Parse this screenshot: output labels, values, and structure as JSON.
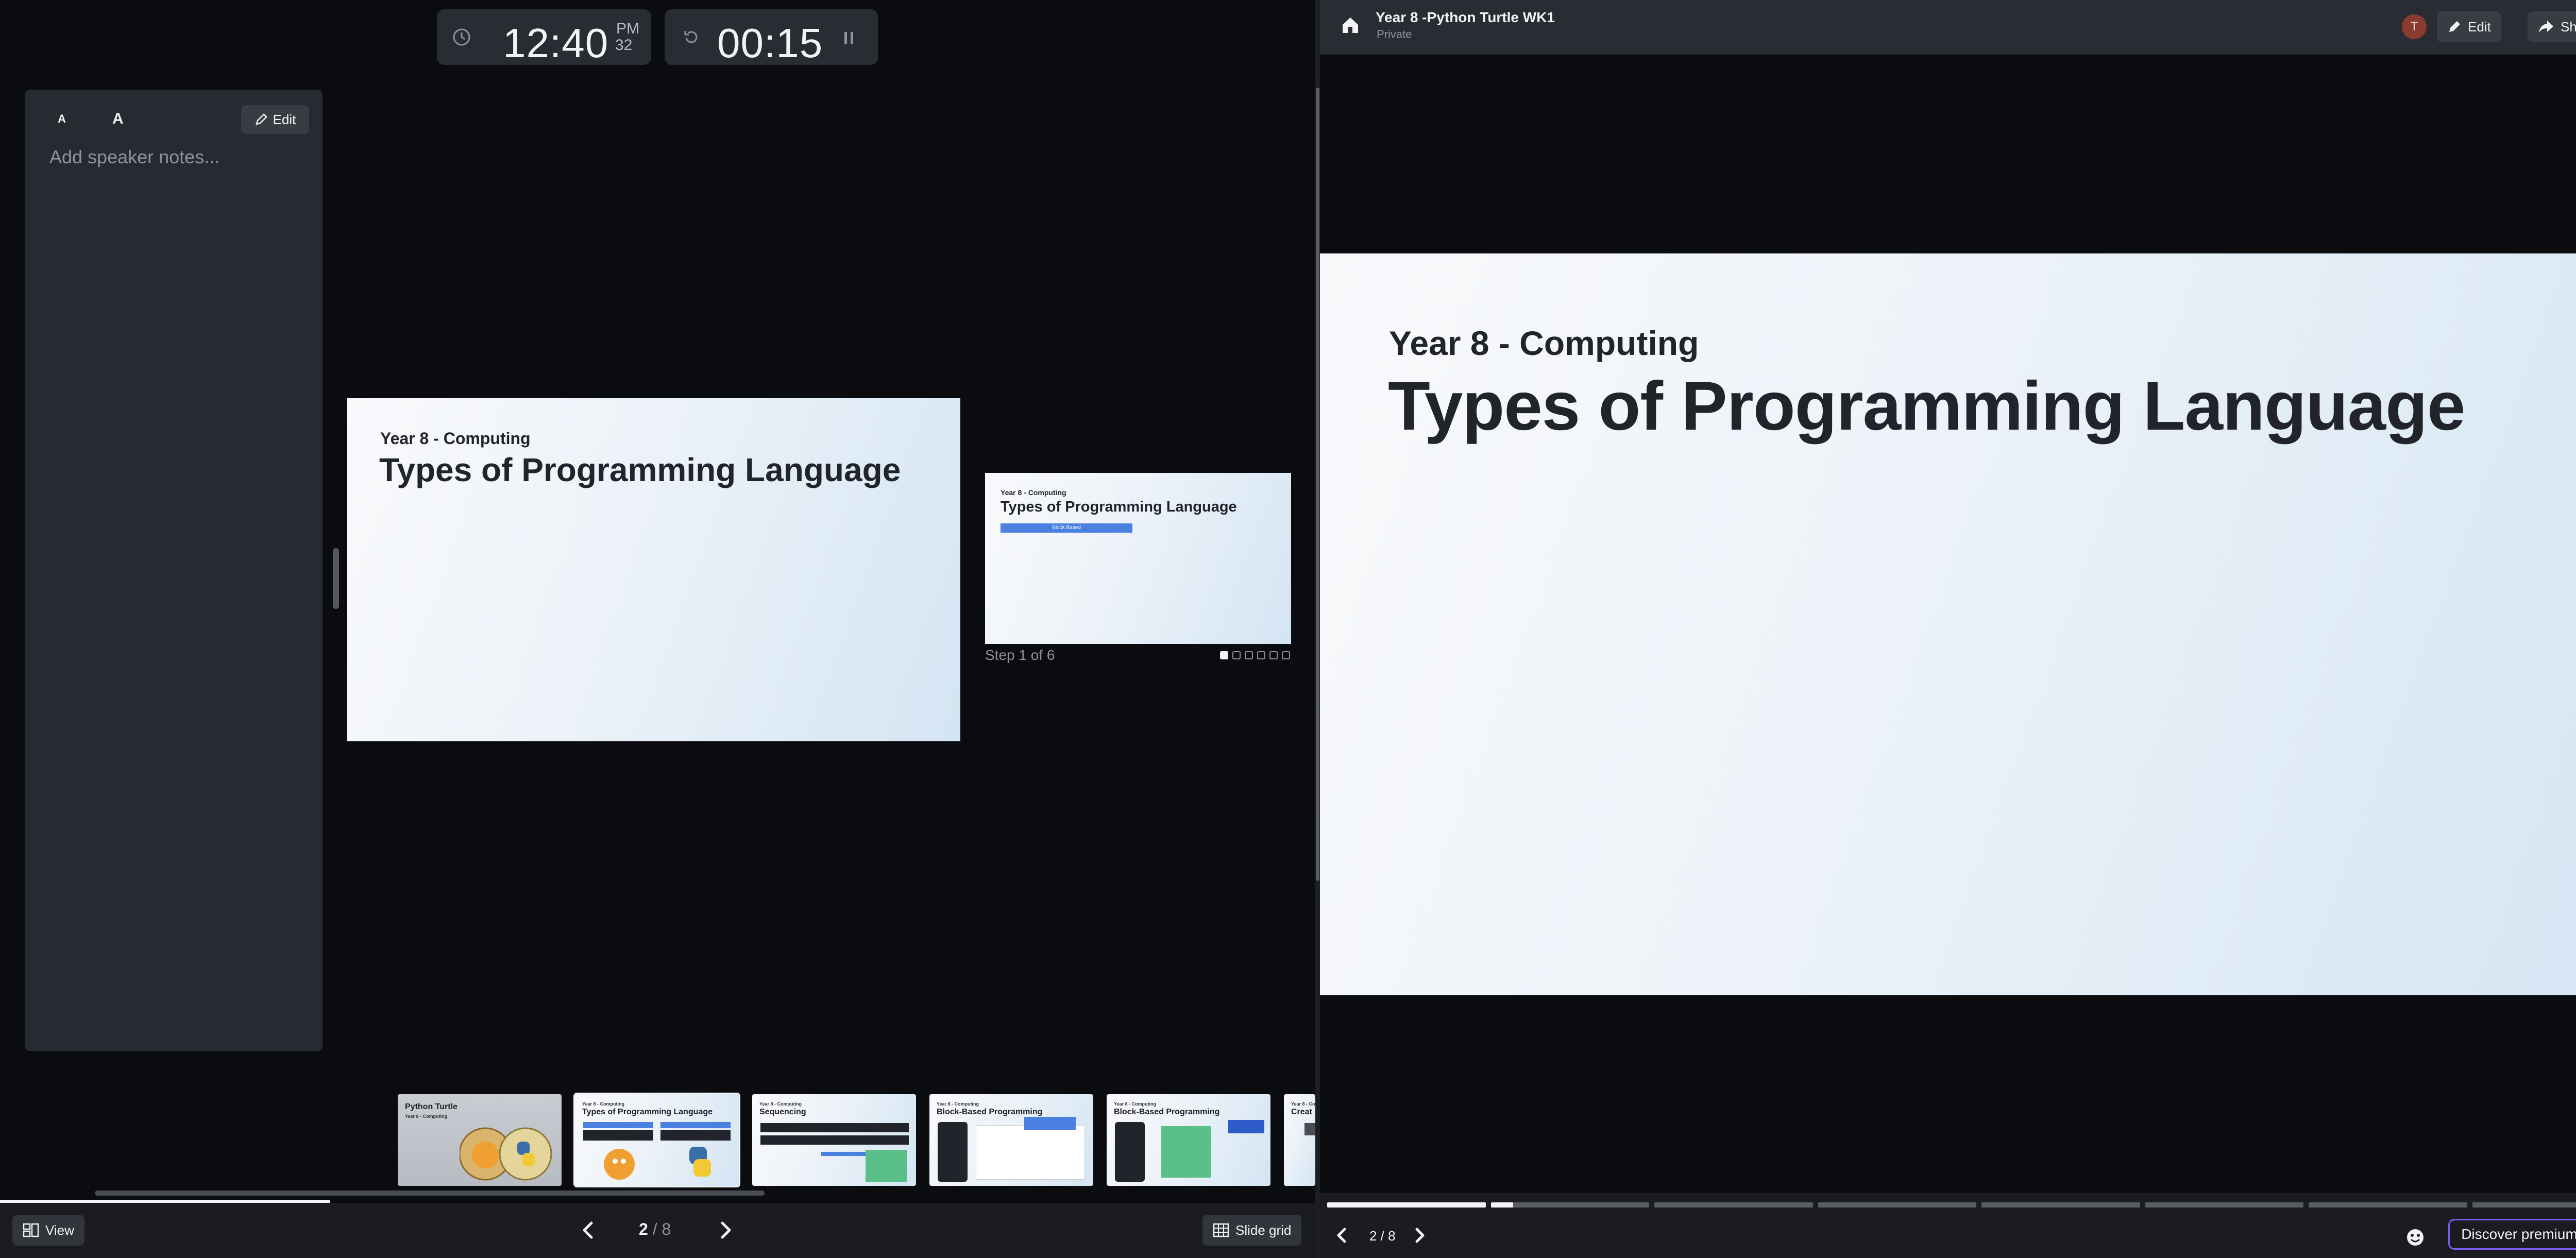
{
  "presenter": {
    "clock": {
      "time": "12:40",
      "ampm": "PM",
      "seconds": "32"
    },
    "timer": {
      "value": "00:15"
    },
    "notes": {
      "edit_label": "Edit",
      "placeholder": "Add speaker notes...",
      "font_small": "A",
      "font_large": "A"
    },
    "current_slide": {
      "subtitle": "Year 8 - Computing",
      "title": "Types of Programming Language"
    },
    "next_slide": {
      "subtitle": "Year 8 - Computing",
      "title": "Types of Programming Language",
      "button_text": "Block Based"
    },
    "step": {
      "label": "Step 1 of 6",
      "current": 1,
      "total": 6
    },
    "thumbnails": [
      {
        "title": "Python Turtle",
        "subtitle": "Year 8 - Computing"
      },
      {
        "title": "Types of Programming Language",
        "subtitle": "Year 8 - Computing"
      },
      {
        "title": "Sequencing",
        "subtitle": "Year 8 - Computing"
      },
      {
        "title": "Block-Based Programming",
        "subtitle": "Year 8 - Computing"
      },
      {
        "title": "Block-Based Programming",
        "subtitle": "Year 8 - Computing"
      },
      {
        "title": "Creat",
        "subtitle": "Year 8 - Co"
      }
    ],
    "bottom": {
      "view_label": "View",
      "page_current": "2",
      "page_sep": " / ",
      "page_total": "8",
      "slide_grid_label": "Slide grid"
    }
  },
  "viewer": {
    "deck_title": "Year 8 -Python Turtle WK1",
    "visibility": "Private",
    "avatar_letter": "T",
    "edit_label": "Edit",
    "share_label": "Share",
    "slide": {
      "subtitle": "Year 8 - Computing",
      "title": "Types of Programming Language"
    },
    "page_indicator": "2 / 8",
    "premium_label": "Discover premium",
    "progress_segments": 8,
    "progress_current": 2
  },
  "colors": {
    "accent": "#4a80e0",
    "premium_border": "#7c5cf0",
    "avatar": "#8a3b2f"
  }
}
